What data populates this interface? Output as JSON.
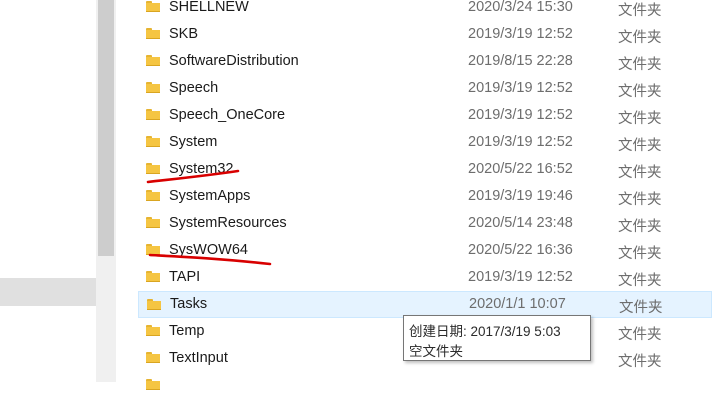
{
  "files": [
    {
      "name": "SHELLNEW",
      "date": "2020/3/24 15:30",
      "type": "文件夹"
    },
    {
      "name": "SKB",
      "date": "2019/3/19 12:52",
      "type": "文件夹"
    },
    {
      "name": "SoftwareDistribution",
      "date": "2019/8/15 22:28",
      "type": "文件夹"
    },
    {
      "name": "Speech",
      "date": "2019/3/19 12:52",
      "type": "文件夹"
    },
    {
      "name": "Speech_OneCore",
      "date": "2019/3/19 12:52",
      "type": "文件夹"
    },
    {
      "name": "System",
      "date": "2019/3/19 12:52",
      "type": "文件夹"
    },
    {
      "name": "System32",
      "date": "2020/5/22 16:52",
      "type": "文件夹"
    },
    {
      "name": "SystemApps",
      "date": "2019/3/19 19:46",
      "type": "文件夹"
    },
    {
      "name": "SystemResources",
      "date": "2020/5/14 23:48",
      "type": "文件夹"
    },
    {
      "name": "SysWOW64",
      "date": "2020/5/22 16:36",
      "type": "文件夹"
    },
    {
      "name": "TAPI",
      "date": "2019/3/19 12:52",
      "type": "文件夹"
    },
    {
      "name": "Tasks",
      "date": "2020/1/1 10:07",
      "type": "文件夹"
    },
    {
      "name": "Temp",
      "date": "",
      "type": "文件夹"
    },
    {
      "name": "TextInput",
      "date": "",
      "type": "文件夹"
    }
  ],
  "tooltip": {
    "line1": "创建日期: 2017/3/19 5:03",
    "line2": "空文件夹"
  },
  "colors": {
    "folder": "#f5c542",
    "hover_bg": "#e5f3ff",
    "annotation": "#d80000"
  },
  "icons": {
    "folder": "folder-icon"
  }
}
